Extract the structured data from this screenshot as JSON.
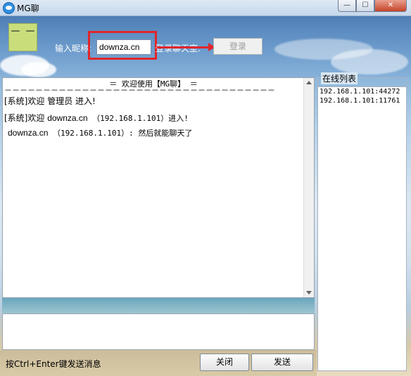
{
  "window": {
    "title": "MG聊",
    "controls": {
      "minimize": "—",
      "maximize": "☐",
      "close": "✕"
    }
  },
  "header": {
    "avatar_text": "－ －",
    "nickname_label": "输入昵称:",
    "nickname_value": "downza.cn",
    "login_room_label": "登录聊天室:",
    "login_button": "登录"
  },
  "chat": {
    "title": "＝ 欢迎使用【MG聊】 ＝",
    "divider": "－－－－－－－－－－－－－－－－－－－－－－－－－－－－－－－－－－－",
    "messages": [
      {
        "prefix": "[系统]欢迎 ",
        "name": "管理员",
        "suffix": " 进入!"
      },
      {
        "prefix": "[系统]欢迎 ",
        "name": "downza.cn",
        "suffix": " （192.168.1.101）进入!"
      },
      {
        "prefix": "",
        "name": "downza.cn",
        "suffix": " （192.168.1.101）: 然后就能聊天了"
      }
    ]
  },
  "footer": {
    "hint": "按Ctrl+Enter键发送消息",
    "close_button": "关闭",
    "send_button": "发送"
  },
  "online": {
    "legend": "在线列表",
    "items": [
      "192.168.1.101:44272",
      "192.168.1.101:11761"
    ]
  },
  "colors": {
    "highlight": "#e0262b",
    "avatar_bg": "#c9de7b"
  }
}
